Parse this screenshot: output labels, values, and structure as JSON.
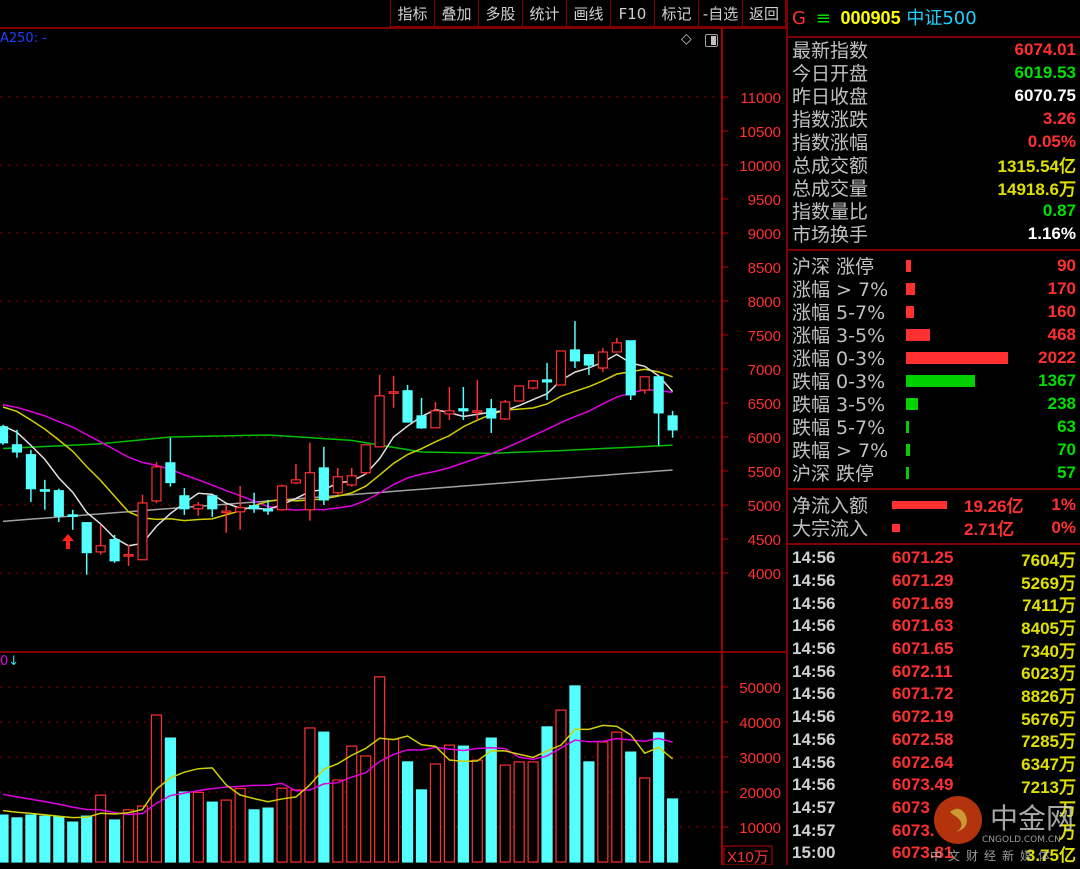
{
  "toolbar": [
    "指标",
    "叠加",
    "多股",
    "统计",
    "画线",
    "F10",
    "标记",
    "-自选",
    "返回"
  ],
  "header": {
    "g": "G",
    "menu": "≡",
    "code": "000905",
    "name": "中证500"
  },
  "ma_label": "A250: -",
  "vol_label": {
    "v": "0",
    "arrow": "↓"
  },
  "icons": [
    "diamond-icon",
    "panel-toggle-icon"
  ],
  "stats": [
    {
      "label": "最新指数",
      "value": "6074.01",
      "color": "#ff3030"
    },
    {
      "label": "今日开盘",
      "value": "6019.53",
      "color": "#00e000"
    },
    {
      "label": "昨日收盘",
      "value": "6070.75",
      "color": "#ffffff"
    },
    {
      "label": "指数涨跌",
      "value": "3.26",
      "color": "#ff3030"
    },
    {
      "label": "指数涨幅",
      "value": "0.05%",
      "color": "#ff3030"
    },
    {
      "label": "总成交额",
      "value": "1315.54亿",
      "color": "#e0e000"
    },
    {
      "label": "总成交量",
      "value": "14918.6万",
      "color": "#e0e000"
    },
    {
      "label": "指数量比",
      "value": "0.87",
      "color": "#00e000"
    },
    {
      "label": "市场换手",
      "value": "1.16%",
      "color": "#ffffff"
    }
  ],
  "breadth": [
    {
      "label": "沪深 涨停",
      "value": "90",
      "n": 90,
      "up": true
    },
    {
      "label": "涨幅 > 7%",
      "value": "170",
      "n": 170,
      "up": true
    },
    {
      "label": "涨幅 5-7%",
      "value": "160",
      "n": 160,
      "up": true
    },
    {
      "label": "涨幅 3-5%",
      "value": "468",
      "n": 468,
      "up": true
    },
    {
      "label": "涨幅 0-3%",
      "value": "2022",
      "n": 2022,
      "up": true
    },
    {
      "label": "跌幅 0-3%",
      "value": "1367",
      "n": 1367,
      "up": false
    },
    {
      "label": "跌幅 3-5%",
      "value": "238",
      "n": 238,
      "up": false
    },
    {
      "label": "跌幅 5-7%",
      "value": "63",
      "n": 63,
      "up": false
    },
    {
      "label": "跌幅 > 7%",
      "value": "70",
      "n": 70,
      "up": false
    },
    {
      "label": "沪深 跌停",
      "value": "57",
      "n": 57,
      "up": false
    }
  ],
  "flows": [
    {
      "label": "净流入额",
      "value": "19.26亿",
      "pct": "1%",
      "amt": 19.26
    },
    {
      "label": "大宗流入",
      "value": "2.71亿",
      "pct": "0%",
      "amt": 2.71
    }
  ],
  "ticks": [
    [
      "14:56",
      "6071.25",
      "7604万"
    ],
    [
      "14:56",
      "6071.29",
      "5269万"
    ],
    [
      "14:56",
      "6071.69",
      "7411万"
    ],
    [
      "14:56",
      "6071.63",
      "8405万"
    ],
    [
      "14:56",
      "6071.65",
      "7340万"
    ],
    [
      "14:56",
      "6072.11",
      "6023万"
    ],
    [
      "14:56",
      "6071.72",
      "8826万"
    ],
    [
      "14:56",
      "6072.19",
      "5676万"
    ],
    [
      "14:56",
      "6072.58",
      "7285万"
    ],
    [
      "14:56",
      "6072.64",
      "6347万"
    ],
    [
      "14:56",
      "6073.49",
      "7213万"
    ],
    [
      "14:57",
      "6073",
      "万"
    ],
    [
      "14:57",
      "6073.",
      "万"
    ],
    [
      "15:00",
      "6073.81",
      "3.75亿"
    ]
  ],
  "watermark": {
    "name": "中金网",
    "url": "CNGOLD.COM.CN",
    "tagline": "中文财经新媒体"
  },
  "chart_data": {
    "type": "candlestick",
    "price_axis": {
      "ticks": [
        11000,
        10500,
        10000,
        9500,
        9000,
        8500,
        8000,
        7500,
        7000,
        6500,
        6000,
        5500,
        5000,
        4500,
        4000
      ]
    },
    "vol_axis": {
      "ticks": [
        50000,
        40000,
        30000,
        20000,
        10000
      ],
      "unit": "X10万"
    },
    "colors": {
      "up": "#ff3030",
      "down": "#54ffff",
      "ma5": "#e0e0e0",
      "ma10": "#d0d000",
      "ma20": "#e000e0",
      "ma60": "#00c000",
      "ma250": "#a0a0a0"
    },
    "ohlc": [
      [
        6150,
        6180,
        5885,
        5915
      ],
      [
        5885,
        6105,
        5695,
        5780
      ],
      [
        5740,
        5810,
        5045,
        5240
      ],
      [
        5225,
        5370,
        4930,
        5220
      ],
      [
        5210,
        5240,
        4750,
        4840
      ],
      [
        4855,
        4930,
        4635,
        4850
      ],
      [
        4740,
        4740,
        3975,
        4300
      ],
      [
        4310,
        4710,
        4270,
        4400
      ],
      [
        4490,
        4560,
        4150,
        4180
      ],
      [
        4265,
        4415,
        4105,
        4270
      ],
      [
        4195,
        5150,
        4190,
        5030
      ],
      [
        5060,
        5635,
        5030,
        5560
      ],
      [
        5620,
        5990,
        5270,
        5330
      ],
      [
        5135,
        5250,
        4855,
        4945
      ],
      [
        4945,
        5045,
        4840,
        5000
      ],
      [
        5135,
        5135,
        4825,
        4945
      ],
      [
        4900,
        5000,
        4590,
        4910
      ],
      [
        4900,
        5280,
        4635,
        4960
      ],
      [
        4990,
        5180,
        4885,
        4945
      ],
      [
        4935,
        5075,
        4855,
        4925
      ],
      [
        4930,
        5300,
        4915,
        5280
      ],
      [
        5325,
        5605,
        5310,
        5370
      ],
      [
        4930,
        5915,
        4770,
        5475
      ],
      [
        5545,
        5855,
        5000,
        5075
      ],
      [
        5180,
        5545,
        5150,
        5415
      ],
      [
        5295,
        5545,
        5270,
        5430
      ],
      [
        5475,
        5885,
        5445,
        5885
      ],
      [
        5855,
        6915,
        5855,
        6605
      ],
      [
        6665,
        6900,
        6430,
        6665
      ],
      [
        6680,
        6765,
        6220,
        6220
      ],
      [
        6310,
        6575,
        6120,
        6135
      ],
      [
        6135,
        6515,
        6135,
        6385
      ],
      [
        6340,
        6735,
        6250,
        6385
      ],
      [
        6415,
        6735,
        6250,
        6385
      ],
      [
        6370,
        6840,
        6250,
        6385
      ],
      [
        6415,
        6560,
        6060,
        6280
      ],
      [
        6265,
        6545,
        6250,
        6515
      ],
      [
        6530,
        6750,
        6530,
        6750
      ],
      [
        6720,
        6840,
        6700,
        6825
      ],
      [
        6840,
        7090,
        6545,
        6810
      ],
      [
        6765,
        7265,
        6765,
        7265
      ],
      [
        7280,
        7705,
        7015,
        7120
      ],
      [
        7210,
        7210,
        6915,
        7060
      ],
      [
        7015,
        7310,
        6955,
        7250
      ],
      [
        7250,
        7460,
        7250,
        7385
      ],
      [
        7415,
        7415,
        6545,
        6620
      ],
      [
        6690,
        6885,
        6635,
        6885
      ],
      [
        6885,
        6885,
        5870,
        6355
      ],
      [
        6310,
        6385,
        5990,
        6105
      ]
    ],
    "volume": [
      13400,
      12600,
      13400,
      13100,
      12900,
      11400,
      13100,
      19100,
      12000,
      14900,
      16000,
      42000,
      35400,
      20000,
      19900,
      17100,
      17700,
      21000,
      14900,
      15400,
      21100,
      20600,
      38300,
      37100,
      23400,
      33100,
      30300,
      52900,
      35100,
      28600,
      20600,
      28000,
      33400,
      33100,
      29100,
      35400,
      27700,
      28600,
      28600,
      38600,
      43400,
      50300,
      28600,
      34300,
      37100,
      31400,
      24000,
      36900,
      18000
    ],
    "ma20_start": [
      6560,
      6500,
      6440
    ],
    "ma60": [
      [
        0,
        5830
      ],
      [
        7,
        5900
      ],
      [
        12,
        6000
      ],
      [
        19,
        6030
      ],
      [
        25,
        5950
      ],
      [
        30,
        5780
      ],
      [
        35,
        5760
      ],
      [
        40,
        5800
      ],
      [
        45,
        5850
      ],
      [
        48,
        5880
      ]
    ],
    "ma250": [
      [
        0,
        4760
      ],
      [
        48,
        5515
      ]
    ]
  }
}
